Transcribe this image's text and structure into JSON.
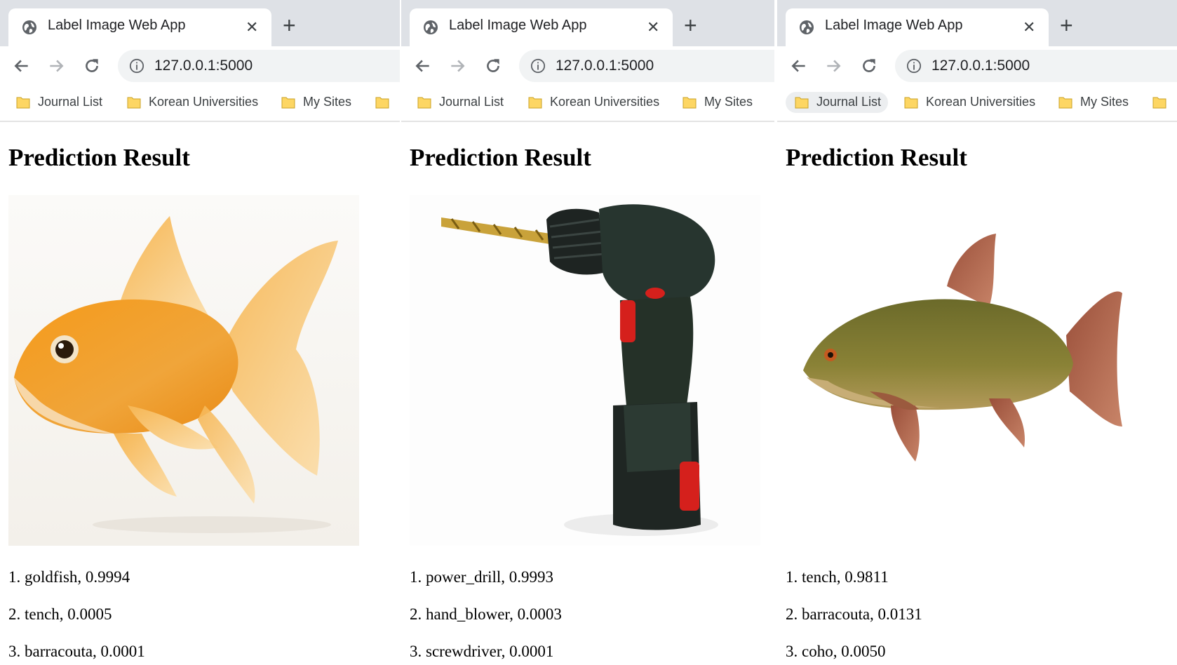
{
  "windows": [
    {
      "tab_title": "Label Image Web App",
      "url": "127.0.0.1:5000",
      "bookmarks": [
        "Journal List",
        "Korean Universities",
        "My Sites"
      ],
      "heading": "Prediction Result",
      "image_subject": "goldfish",
      "predictions": [
        "1. goldfish, 0.9994",
        "2. tench, 0.0005",
        "3. barracouta, 0.0001"
      ]
    },
    {
      "tab_title": "Label Image Web App",
      "url": "127.0.0.1:5000",
      "bookmarks": [
        "Journal List",
        "Korean Universities",
        "My Sites"
      ],
      "heading": "Prediction Result",
      "image_subject": "power drill",
      "predictions": [
        "1. power_drill, 0.9993",
        "2. hand_blower, 0.0003",
        "3. screwdriver, 0.0001"
      ]
    },
    {
      "tab_title": "Label Image Web App",
      "url": "127.0.0.1:5000",
      "bookmarks": [
        "Journal List",
        "Korean Universities",
        "My Sites"
      ],
      "heading": "Prediction Result",
      "image_subject": "tench",
      "predictions": [
        "1. tench, 0.9811",
        "2. barracouta, 0.0131",
        "3. coho, 0.0050"
      ]
    }
  ],
  "icons": {
    "favicon": "globe-icon",
    "close": "close-icon",
    "new_tab": "plus-icon",
    "back": "back-arrow-icon",
    "forward": "forward-arrow-icon",
    "reload": "reload-icon",
    "info": "info-icon",
    "bookmark": "folder-icon"
  },
  "colors": {
    "tab_strip": "#dee1e6",
    "omnibox": "#f1f3f4",
    "folder": "#fdd663"
  }
}
